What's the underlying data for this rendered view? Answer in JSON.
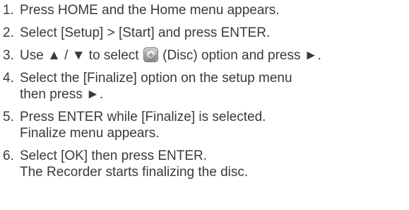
{
  "steps": [
    {
      "number": "1.",
      "lines": [
        "Press HOME and the Home menu appears."
      ]
    },
    {
      "number": "2.",
      "lines": [
        "Select [Setup] > [Start] and press ENTER."
      ]
    },
    {
      "number": "3.",
      "text_before_icon": "Use ▲ / ▼ to select",
      "icon": "disc-icon",
      "text_after_icon": "(Disc) option and press ►."
    },
    {
      "number": "4.",
      "lines": [
        "Select the [Finalize] option on the setup menu",
        "then press ►."
      ]
    },
    {
      "number": "5.",
      "lines": [
        "Press ENTER while [Finalize] is selected.",
        "Finalize menu appears."
      ]
    },
    {
      "number": "6.",
      "lines": [
        "Select [OK] then press ENTER.",
        "The Recorder starts finalizing the disc."
      ]
    }
  ]
}
